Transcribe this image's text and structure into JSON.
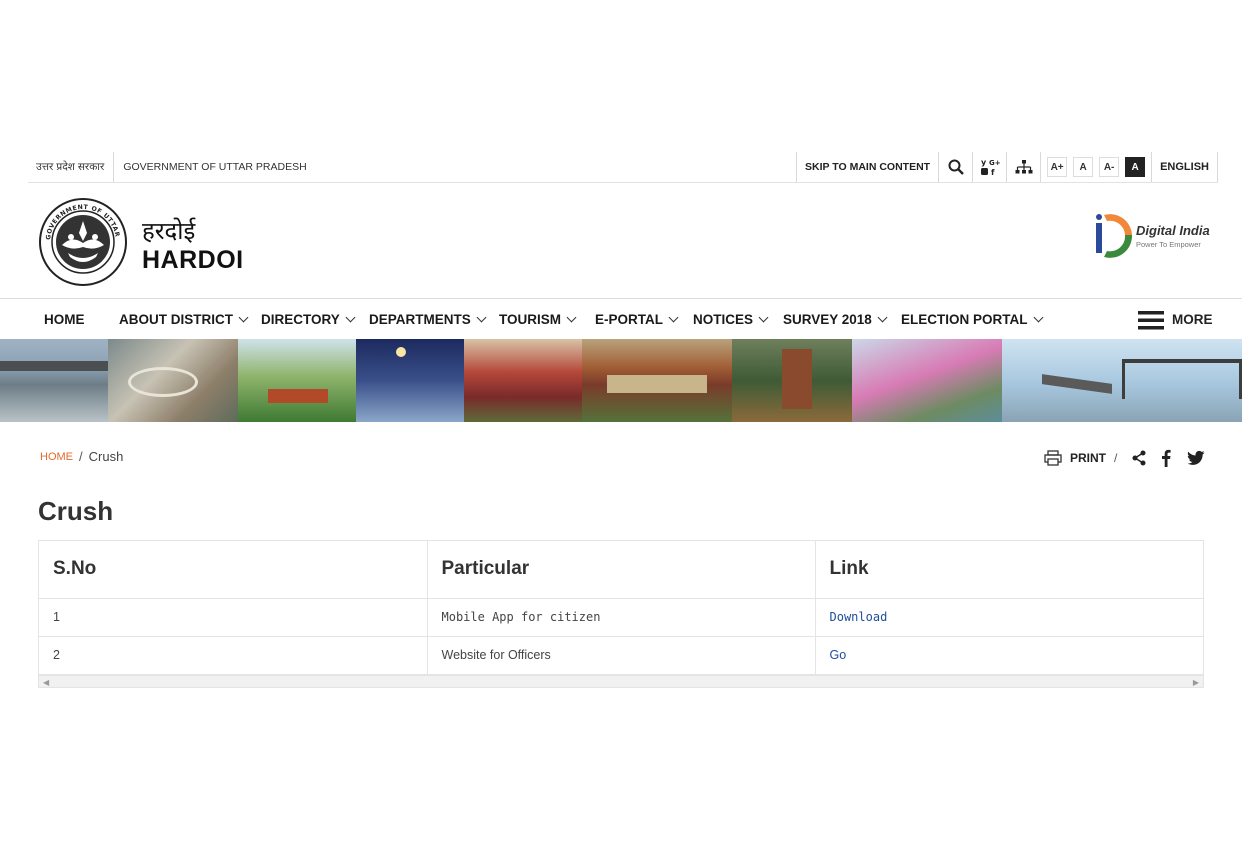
{
  "topbar": {
    "gov_hindi": "उत्तर प्रदेश सरकार",
    "gov_english": "GOVERNMENT OF UTTAR PRADESH",
    "skip_label": "SKIP TO MAIN CONTENT",
    "font_sizes": [
      "A+",
      "A",
      "A-",
      "A"
    ],
    "language": "ENGLISH"
  },
  "header": {
    "title_hindi": "हरदोई",
    "title_english": "HARDOI",
    "emblem_text": "GOVERNMENT OF UTTAR PRADESH",
    "digital_india_title": "Digital India",
    "digital_india_tagline": "Power To Empower"
  },
  "nav": {
    "items": [
      {
        "label": "HOME"
      },
      {
        "label": "ABOUT DISTRICT"
      },
      {
        "label": "DIRECTORY"
      },
      {
        "label": "DEPARTMENTS"
      },
      {
        "label": "TOURISM"
      },
      {
        "label": "E-PORTAL"
      },
      {
        "label": "NOTICES"
      },
      {
        "label": "SURVEY 2018"
      },
      {
        "label": "ELECTION PORTAL"
      }
    ],
    "more_label": "MORE"
  },
  "breadcrumb": {
    "home": "HOME",
    "separator": "/",
    "current": "Crush"
  },
  "share": {
    "print_label": "PRINT",
    "separator": "/"
  },
  "page": {
    "title": "Crush"
  },
  "table": {
    "headers": [
      "S.No",
      "Particular",
      "Link"
    ],
    "rows": [
      {
        "sno": "1",
        "particular": "Mobile App for citizen",
        "link": "Download"
      },
      {
        "sno": "2",
        "particular": "Website for Officers",
        "link": "Go"
      }
    ]
  },
  "colors": {
    "accent_orange": "#e36a2c",
    "link_blue": "#1f4e9a",
    "text_dark": "#222222"
  }
}
